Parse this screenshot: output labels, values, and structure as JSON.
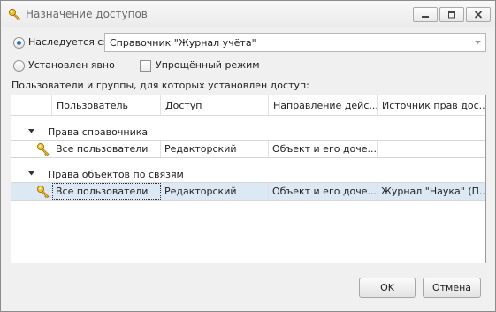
{
  "window": {
    "title": "Назначение доступов",
    "icon": "key-icon",
    "controls": [
      "minimize-icon",
      "maximize-icon",
      "close-icon"
    ]
  },
  "inherit": {
    "label": "Наследуется с:",
    "selected": true,
    "value": "Справочник \"Журнал учёта\""
  },
  "explicit": {
    "label": "Установлен явно",
    "selected": false
  },
  "simplified": {
    "label": "Упрощённый режим",
    "checked": false
  },
  "grid_caption": "Пользователи и группы, для которых установлен доступ:",
  "grid": {
    "columns": [
      "Пользователь",
      "Доступ",
      "Направление дейс...",
      "Источник прав дос..."
    ],
    "groups": [
      {
        "label": "Права справочника",
        "rows": [
          {
            "user": "Все пользователи",
            "access": "Редакторский",
            "direction": "Объект и его доче...",
            "source": ""
          }
        ]
      },
      {
        "label": "Права объектов по связям",
        "rows": [
          {
            "user": "Все пользователи",
            "access": "Редакторский",
            "direction": "Объект и его доче...",
            "source": "Журнал \"Наука\" (П..."
          }
        ]
      }
    ]
  },
  "buttons": {
    "ok": "OK",
    "cancel": "Отмена"
  },
  "colors": {
    "selection": "#dde8f5",
    "accent": "#3b6fb6",
    "key": "#e0b020"
  }
}
